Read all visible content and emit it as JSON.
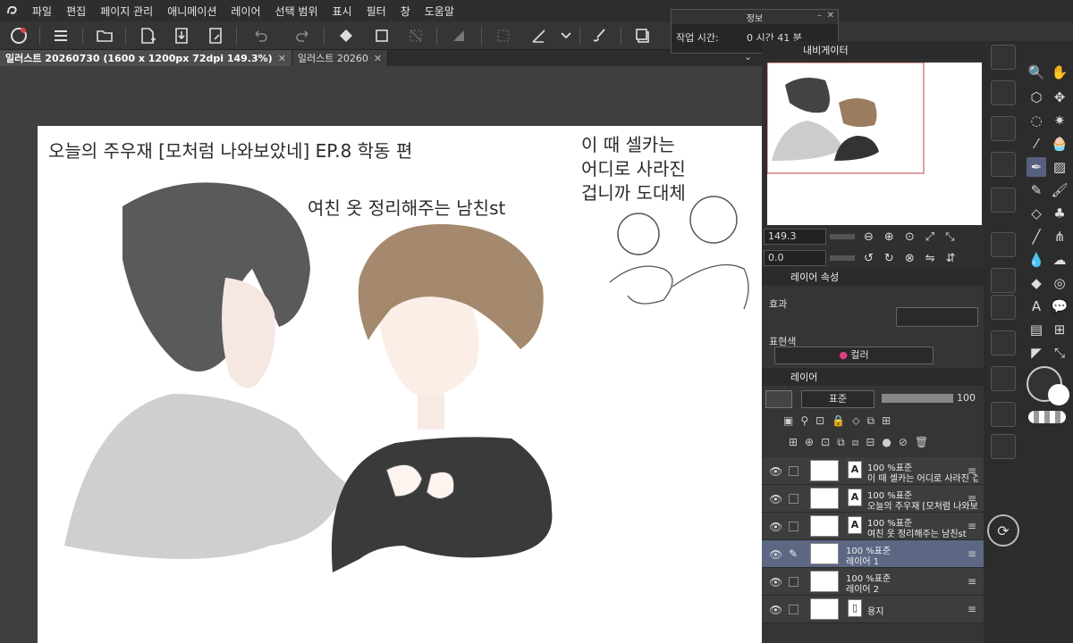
{
  "menu": {
    "items": [
      "파일",
      "편집",
      "페이지 관리",
      "애니메이션",
      "레이어",
      "선택 범위",
      "표시",
      "필터",
      "창",
      "도움말"
    ]
  },
  "tabs": [
    {
      "label": "일러스트 20260730 (1600 x 1200px 72dpi 149.3%)",
      "active": true
    },
    {
      "label": "일러스트 20260",
      "active": false
    }
  ],
  "info": {
    "title": "정보",
    "label": "작업 시간:",
    "value": "0 시간 41 분"
  },
  "canvas": {
    "title": "오늘의 주우재 [모처럼 나와보았네] EP.8 학동 편",
    "caption": "여친 옷 정리해주는 남친st",
    "note_lines": [
      "이 때 셀카는",
      "어디로 사라진",
      "겁니까 도대체"
    ]
  },
  "navigator": {
    "title": "내비게이터",
    "zoom": "149.3",
    "rotation": "0.0"
  },
  "layer_property": {
    "title": "레이어 속성",
    "effect_label": "효과",
    "expression_label": "표현색",
    "color_value": "컬러"
  },
  "layer_panel": {
    "title": "레이어",
    "blend_mode": "표준",
    "opacity": "100",
    "layers": [
      {
        "opacity_mode": "100 %표준",
        "name": "이 때 셀카는 어디로 사라진 겁니",
        "type": "text",
        "selected": false
      },
      {
        "opacity_mode": "100 %표준",
        "name": "오늘의 주우재 [모처럼 나와보았",
        "type": "text",
        "selected": false
      },
      {
        "opacity_mode": "100 %표준",
        "name": "여친 옷 정리해주는 남친st",
        "type": "text",
        "selected": false
      },
      {
        "opacity_mode": "100 %표준",
        "name": "레이어 1",
        "type": "raster",
        "selected": true
      },
      {
        "opacity_mode": "100 %표준",
        "name": "레이어 2",
        "type": "raster",
        "selected": false
      },
      {
        "opacity_mode": "",
        "name": "용지",
        "type": "paper",
        "selected": false
      }
    ]
  },
  "colors": {
    "accent": "#5c6784",
    "bg": "#3a3a3a",
    "panel": "#353535"
  }
}
